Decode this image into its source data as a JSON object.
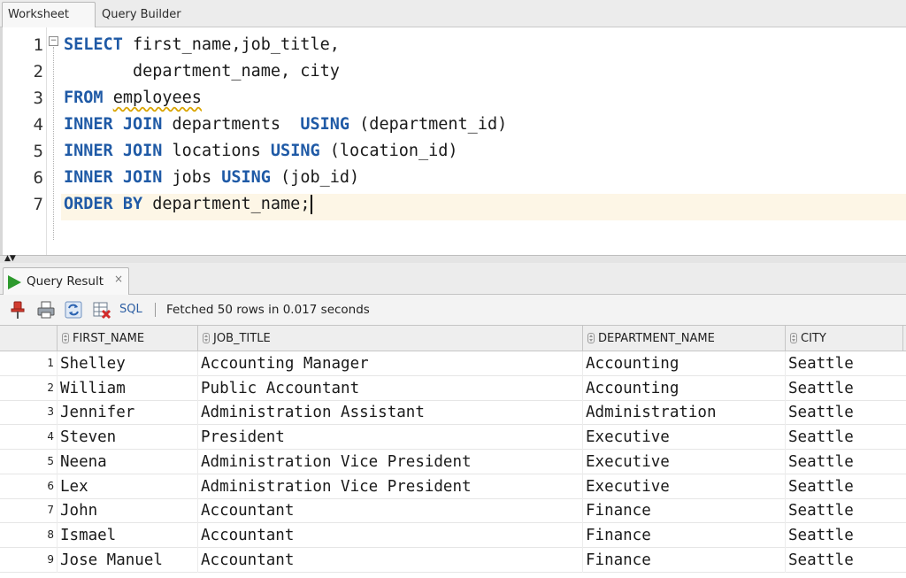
{
  "editor_tabs": [
    {
      "label": "Worksheet"
    },
    {
      "label": "Query Builder"
    }
  ],
  "code": {
    "line_numbers": [
      "1",
      "2",
      "3",
      "4",
      "5",
      "6",
      "7"
    ],
    "lines": [
      [
        {
          "kw": "SELECT"
        },
        {
          "t": " first_name,job_title,"
        }
      ],
      [
        {
          "t": "       department_name, city"
        }
      ],
      [
        {
          "kw": "FROM"
        },
        {
          "t": " "
        },
        {
          "sq": "employees"
        }
      ],
      [
        {
          "kw": "INNER JOIN"
        },
        {
          "t": " departments  "
        },
        {
          "kw": "USING"
        },
        {
          "t": " (department_id)"
        }
      ],
      [
        {
          "kw": "INNER JOIN"
        },
        {
          "t": " locations "
        },
        {
          "kw": "USING"
        },
        {
          "t": " (location_id)"
        }
      ],
      [
        {
          "kw": "INNER JOIN"
        },
        {
          "t": " jobs "
        },
        {
          "kw": "USING"
        },
        {
          "t": " (job_id)"
        }
      ],
      [
        {
          "kw": "ORDER BY"
        },
        {
          "t": " department_name;"
        }
      ]
    ]
  },
  "result_tab": {
    "label": "Query Result",
    "close": "×"
  },
  "toolbar": {
    "sql_label": "SQL",
    "status": "Fetched 50 rows in 0.017 seconds"
  },
  "grid": {
    "columns": [
      "FIRST_NAME",
      "JOB_TITLE",
      "DEPARTMENT_NAME",
      "CITY"
    ],
    "rows": [
      {
        "n": "1",
        "cells": [
          "Shelley",
          "Accounting Manager",
          "Accounting",
          "Seattle"
        ]
      },
      {
        "n": "2",
        "cells": [
          "William",
          "Public Accountant",
          "Accounting",
          "Seattle"
        ]
      },
      {
        "n": "3",
        "cells": [
          "Jennifer",
          "Administration Assistant",
          "Administration",
          "Seattle"
        ]
      },
      {
        "n": "4",
        "cells": [
          "Steven",
          "President",
          "Executive",
          "Seattle"
        ]
      },
      {
        "n": "5",
        "cells": [
          "Neena",
          "Administration Vice President",
          "Executive",
          "Seattle"
        ]
      },
      {
        "n": "6",
        "cells": [
          "Lex",
          "Administration Vice President",
          "Executive",
          "Seattle"
        ]
      },
      {
        "n": "7",
        "cells": [
          "John",
          "Accountant",
          "Finance",
          "Seattle"
        ]
      },
      {
        "n": "8",
        "cells": [
          "Ismael",
          "Accountant",
          "Finance",
          "Seattle"
        ]
      },
      {
        "n": "9",
        "cells": [
          "Jose Manuel",
          "Accountant",
          "Finance",
          "Seattle"
        ]
      }
    ]
  },
  "colors": {
    "keyword": "#1f5aa6",
    "run_icon": "#2e9a2e",
    "current_line": "#fdf6e6"
  }
}
